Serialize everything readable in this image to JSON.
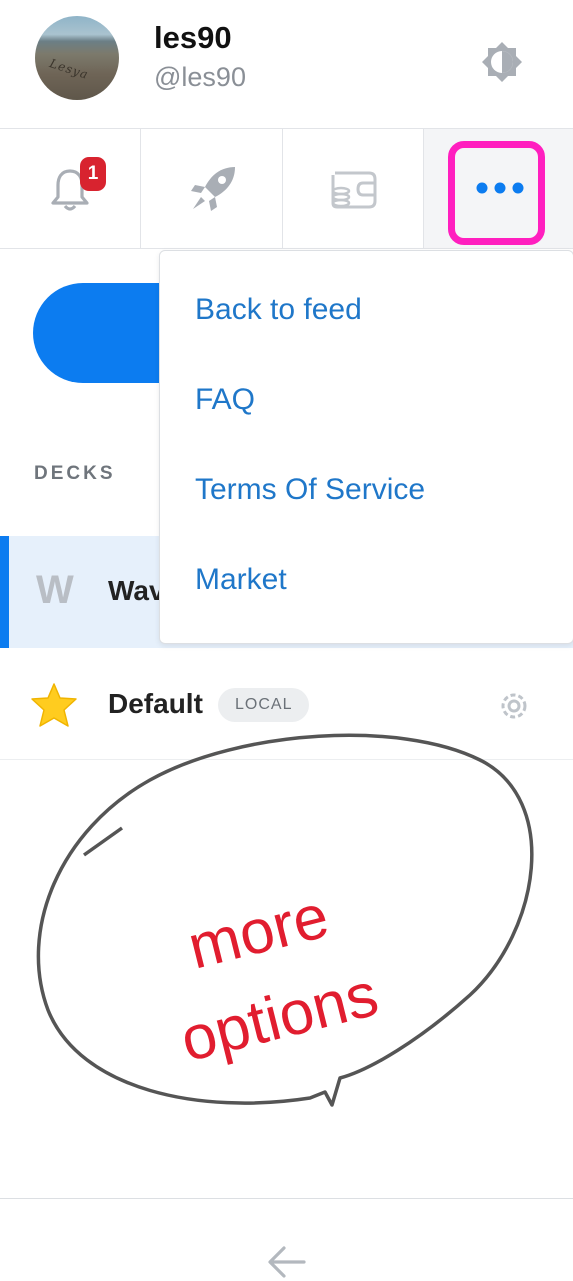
{
  "profile": {
    "username": "les90",
    "handle": "@les90",
    "avatar_icon": "profile-photo-beach-icon",
    "avatar_writing": "Lesya"
  },
  "tabs": [
    {
      "name": "notifications",
      "icon": "bell-icon",
      "badge": "1"
    },
    {
      "name": "promote",
      "icon": "rocket-icon"
    },
    {
      "name": "wallet",
      "icon": "wallet-icon"
    },
    {
      "name": "more",
      "icon": "more-dots-icon"
    }
  ],
  "menu": {
    "items": [
      "Back to feed",
      "FAQ",
      "Terms Of Service",
      "Market"
    ]
  },
  "decks": {
    "label": "DECKS",
    "items": [
      {
        "initial": "W",
        "name": "Wav",
        "active": true
      },
      {
        "icon": "star-icon",
        "name": "Default",
        "badge": "LOCAL"
      }
    ]
  },
  "annotation": {
    "line1": "more",
    "line2": "options",
    "color": "#e11d2f",
    "highlight_color": "#ff1fbf"
  },
  "colors": {
    "accent": "#0c7cf0",
    "link": "#1f77c9",
    "badge": "#d8232f"
  }
}
